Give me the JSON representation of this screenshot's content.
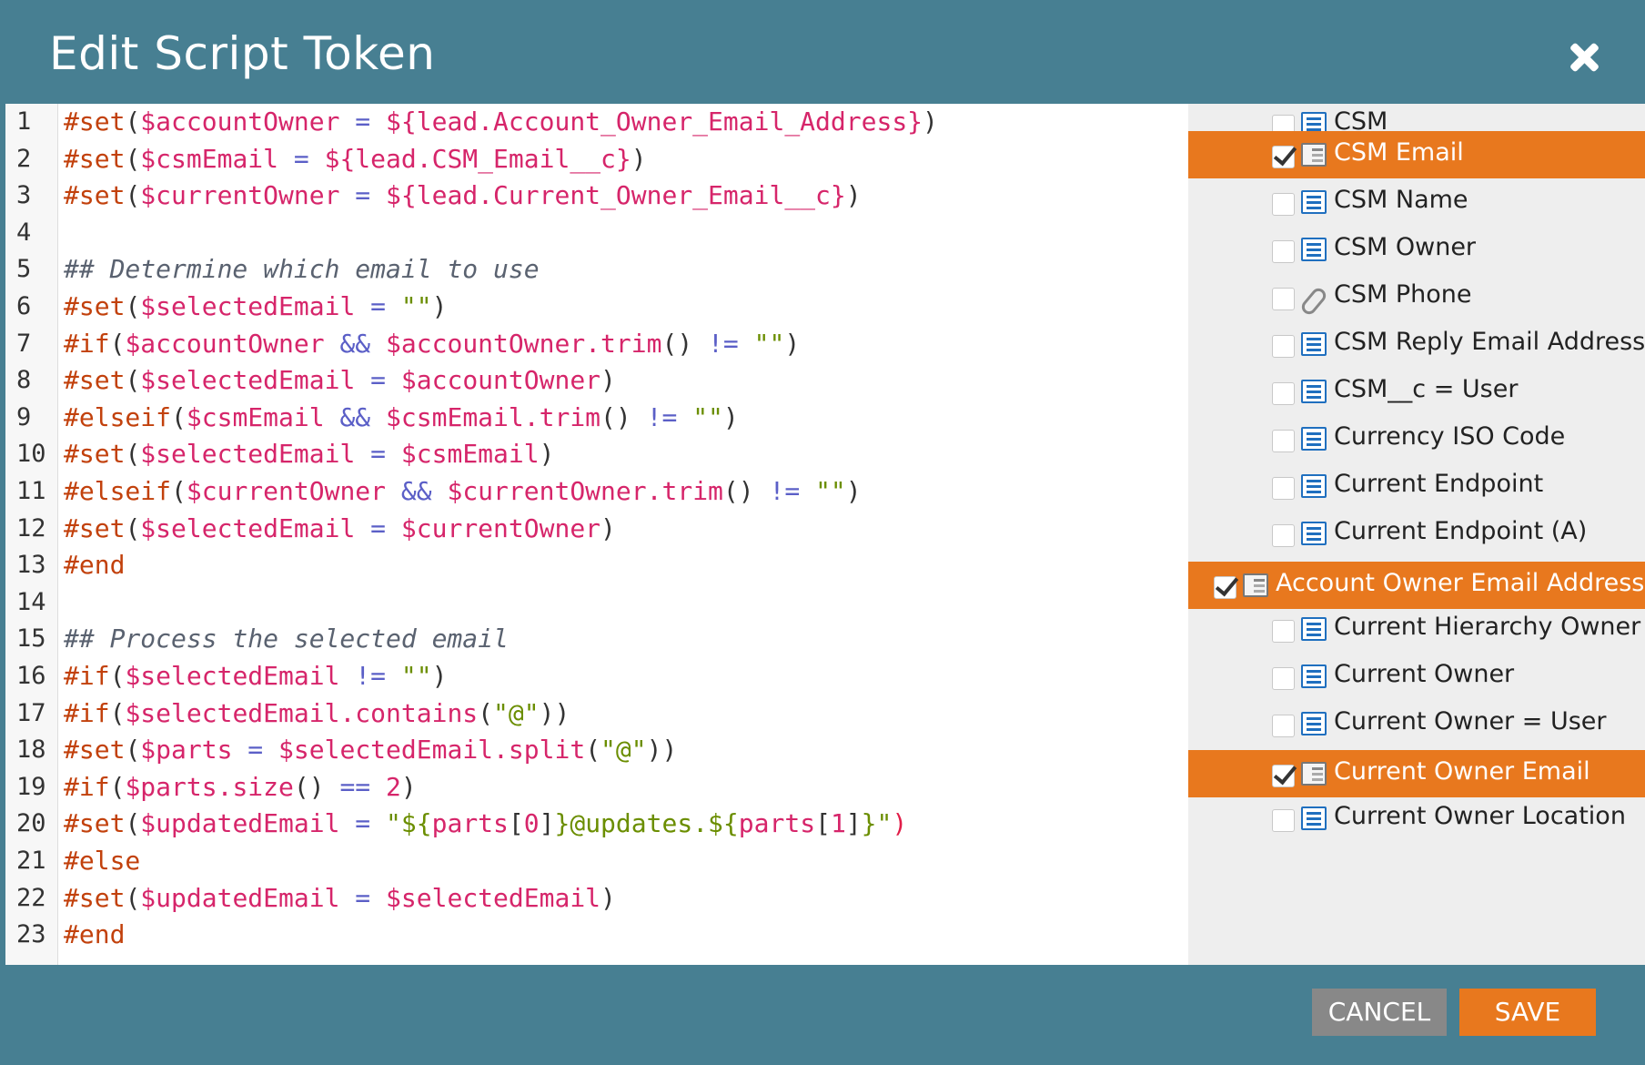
{
  "dialog": {
    "title": "Edit Script Token"
  },
  "editor": {
    "lines": [
      {
        "n": "1"
      },
      {
        "n": "2"
      },
      {
        "n": "3"
      },
      {
        "n": "4"
      },
      {
        "n": "5"
      },
      {
        "n": "6"
      },
      {
        "n": "7"
      },
      {
        "n": "8"
      },
      {
        "n": "9"
      },
      {
        "n": "10"
      },
      {
        "n": "11"
      },
      {
        "n": "12"
      },
      {
        "n": "13"
      },
      {
        "n": "14"
      },
      {
        "n": "15"
      },
      {
        "n": "16"
      },
      {
        "n": "17"
      },
      {
        "n": "18"
      },
      {
        "n": "19"
      },
      {
        "n": "20"
      },
      {
        "n": "21"
      },
      {
        "n": "22"
      },
      {
        "n": "23"
      }
    ],
    "code": [
      [
        [
          "kw",
          "#set"
        ],
        [
          "pun",
          "("
        ],
        [
          "var",
          "$accountOwner"
        ],
        [
          "op",
          " = "
        ],
        [
          "var",
          "${lead.Account_Owner_Email_Address}"
        ],
        [
          "pun",
          ")"
        ]
      ],
      [
        [
          "kw",
          "#set"
        ],
        [
          "pun",
          "("
        ],
        [
          "var",
          "$csmEmail"
        ],
        [
          "op",
          " = "
        ],
        [
          "var",
          "${lead.CSM_Email__c}"
        ],
        [
          "pun",
          ")"
        ]
      ],
      [
        [
          "kw",
          "#set"
        ],
        [
          "pun",
          "("
        ],
        [
          "var",
          "$currentOwner"
        ],
        [
          "op",
          " = "
        ],
        [
          "var",
          "${lead.Current_Owner_Email__c}"
        ],
        [
          "pun",
          ")"
        ]
      ],
      [],
      [
        [
          "cmt",
          "## Determine which email to use"
        ]
      ],
      [
        [
          "kw",
          "#set"
        ],
        [
          "pun",
          "("
        ],
        [
          "var",
          "$selectedEmail"
        ],
        [
          "op",
          " = "
        ],
        [
          "str",
          "\"\""
        ],
        [
          "pun",
          ")"
        ]
      ],
      [
        [
          "kw",
          "#if"
        ],
        [
          "pun",
          "("
        ],
        [
          "var",
          "$accountOwner"
        ],
        [
          "op",
          " && "
        ],
        [
          "var",
          "$accountOwner.trim"
        ],
        [
          "pun",
          "()"
        ],
        [
          "op",
          " != "
        ],
        [
          "str",
          "\"\""
        ],
        [
          "pun",
          ")"
        ]
      ],
      [
        [
          "kw",
          "#set"
        ],
        [
          "pun",
          "("
        ],
        [
          "var",
          "$selectedEmail"
        ],
        [
          "op",
          " = "
        ],
        [
          "var",
          "$accountOwner"
        ],
        [
          "pun",
          ")"
        ]
      ],
      [
        [
          "kw",
          "#elseif"
        ],
        [
          "pun",
          "("
        ],
        [
          "var",
          "$csmEmail"
        ],
        [
          "op",
          " && "
        ],
        [
          "var",
          "$csmEmail.trim"
        ],
        [
          "pun",
          "()"
        ],
        [
          "op",
          " != "
        ],
        [
          "str",
          "\"\""
        ],
        [
          "pun",
          ")"
        ]
      ],
      [
        [
          "kw",
          "#set"
        ],
        [
          "pun",
          "("
        ],
        [
          "var",
          "$selectedEmail"
        ],
        [
          "op",
          " = "
        ],
        [
          "var",
          "$csmEmail"
        ],
        [
          "pun",
          ")"
        ]
      ],
      [
        [
          "kw",
          "#elseif"
        ],
        [
          "pun",
          "("
        ],
        [
          "var",
          "$currentOwner"
        ],
        [
          "op",
          " && "
        ],
        [
          "var",
          "$currentOwner.trim"
        ],
        [
          "pun",
          "()"
        ],
        [
          "op",
          " != "
        ],
        [
          "str",
          "\"\""
        ],
        [
          "pun",
          ")"
        ]
      ],
      [
        [
          "kw",
          "#set"
        ],
        [
          "pun",
          "("
        ],
        [
          "var",
          "$selectedEmail"
        ],
        [
          "op",
          " = "
        ],
        [
          "var",
          "$currentOwner"
        ],
        [
          "pun",
          ")"
        ]
      ],
      [
        [
          "kw",
          "#end"
        ]
      ],
      [],
      [
        [
          "cmt",
          "## Process the selected email"
        ]
      ],
      [
        [
          "kw",
          "#if"
        ],
        [
          "pun",
          "("
        ],
        [
          "var",
          "$selectedEmail"
        ],
        [
          "op",
          " != "
        ],
        [
          "str",
          "\"\""
        ],
        [
          "pun",
          ")"
        ]
      ],
      [
        [
          "kw",
          "#if"
        ],
        [
          "pun",
          "("
        ],
        [
          "var",
          "$selectedEmail.contains"
        ],
        [
          "pun",
          "("
        ],
        [
          "str",
          "\"@\""
        ],
        [
          "pun",
          "))"
        ]
      ],
      [
        [
          "kw",
          "#set"
        ],
        [
          "pun",
          "("
        ],
        [
          "var",
          "$parts"
        ],
        [
          "op",
          " = "
        ],
        [
          "var",
          "$selectedEmail.split"
        ],
        [
          "pun",
          "("
        ],
        [
          "str",
          "\"@\""
        ],
        [
          "pun",
          "))"
        ]
      ],
      [
        [
          "kw",
          "#if"
        ],
        [
          "pun",
          "("
        ],
        [
          "var",
          "$parts.size"
        ],
        [
          "pun",
          "()"
        ],
        [
          "op",
          " == "
        ],
        [
          "num",
          "2"
        ],
        [
          "pun",
          ")"
        ]
      ],
      [
        [
          "kw",
          "#set"
        ],
        [
          "pun",
          "("
        ],
        [
          "var",
          "$updatedEmail"
        ],
        [
          "op",
          " = "
        ],
        [
          "str",
          "\"${"
        ],
        [
          "var",
          "parts"
        ],
        [
          "pun",
          "["
        ],
        [
          "num",
          "0"
        ],
        [
          "pun",
          "]"
        ],
        [
          "str",
          "}@updates.${"
        ],
        [
          "var",
          "parts"
        ],
        [
          "pun",
          "["
        ],
        [
          "num",
          "1"
        ],
        [
          "pun",
          "]"
        ],
        [
          "str",
          "}\""
        ],
        [
          "red",
          ")"
        ]
      ],
      [
        [
          "kw",
          "#else"
        ]
      ],
      [
        [
          "kw",
          "#set"
        ],
        [
          "pun",
          "("
        ],
        [
          "var",
          "$updatedEmail"
        ],
        [
          "op",
          " = "
        ],
        [
          "var",
          "$selectedEmail"
        ],
        [
          "pun",
          ")"
        ]
      ],
      [
        [
          "kw",
          "#end"
        ]
      ]
    ]
  },
  "fields": [
    {
      "label": "CSM",
      "checked": false,
      "selected": false,
      "icon": "text-field-icon",
      "indent": 1
    },
    {
      "label": "CSM Email",
      "checked": true,
      "selected": true,
      "icon": "email-field-icon",
      "indent": 1
    },
    {
      "label": "CSM Name",
      "checked": false,
      "selected": false,
      "icon": "text-field-icon",
      "indent": 1
    },
    {
      "label": "CSM Owner",
      "checked": false,
      "selected": false,
      "icon": "text-field-icon",
      "indent": 1
    },
    {
      "label": "CSM Phone",
      "checked": false,
      "selected": false,
      "icon": "phone-field-icon",
      "indent": 1
    },
    {
      "label": "CSM Reply Email Address",
      "checked": false,
      "selected": false,
      "icon": "text-field-icon",
      "indent": 1
    },
    {
      "label": "CSM__c = User",
      "checked": false,
      "selected": false,
      "icon": "text-field-icon",
      "indent": 1
    },
    {
      "label": "Currency ISO Code",
      "checked": false,
      "selected": false,
      "icon": "text-field-icon",
      "indent": 1
    },
    {
      "label": "Current Endpoint",
      "checked": false,
      "selected": false,
      "icon": "text-field-icon",
      "indent": 1
    },
    {
      "label": "Current Endpoint (A)",
      "checked": false,
      "selected": false,
      "icon": "text-field-icon",
      "indent": 1
    },
    {
      "label": "Account Owner Email Address",
      "checked": true,
      "selected": true,
      "icon": "email-field-icon",
      "indent": 0
    },
    {
      "label": "Current Hierarchy Owner M",
      "checked": false,
      "selected": false,
      "icon": "text-field-icon",
      "indent": 1
    },
    {
      "label": "Current Owner",
      "checked": false,
      "selected": false,
      "icon": "text-field-icon",
      "indent": 1
    },
    {
      "label": "Current Owner = User",
      "checked": false,
      "selected": false,
      "icon": "text-field-icon",
      "indent": 1
    },
    {
      "label": "Current Owner Email",
      "checked": true,
      "selected": true,
      "icon": "email-field-icon",
      "indent": 1
    },
    {
      "label": "Current Owner Location",
      "checked": false,
      "selected": false,
      "icon": "text-field-icon",
      "indent": 1
    }
  ],
  "footer": {
    "cancel_label": "CANCEL",
    "save_label": "SAVE"
  },
  "colors": {
    "header": "#477f92",
    "accent": "#e8781e",
    "cancel": "#888888"
  }
}
